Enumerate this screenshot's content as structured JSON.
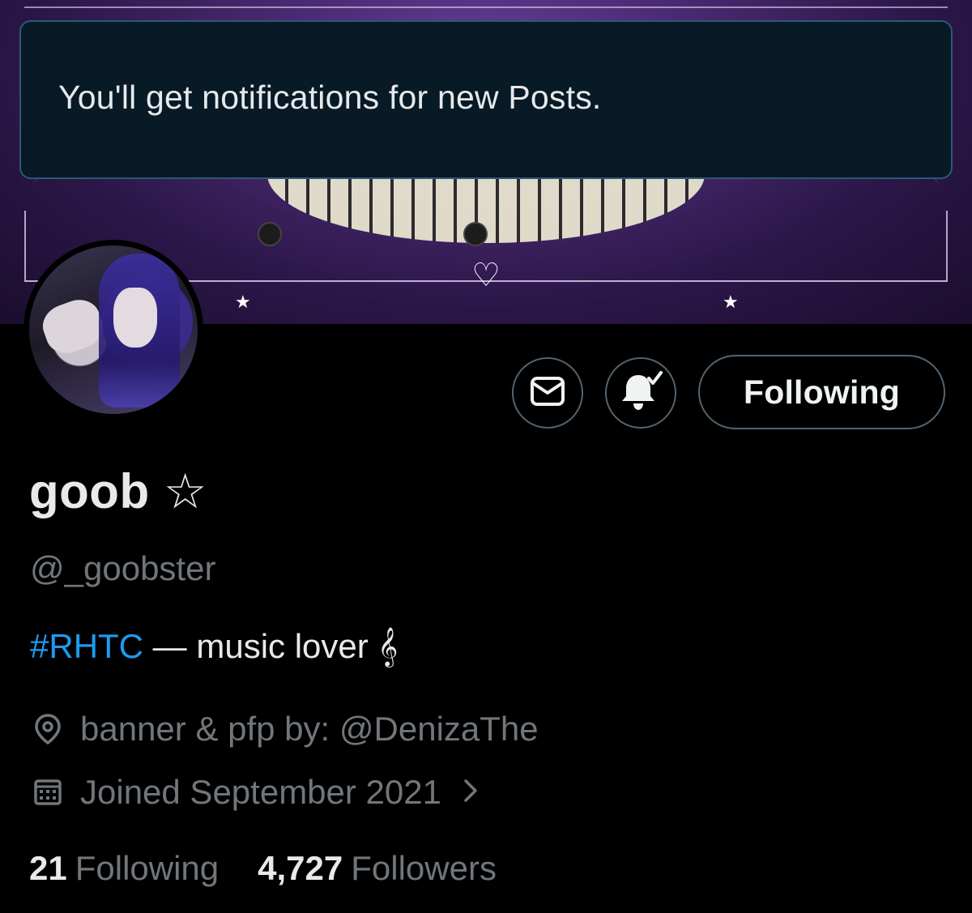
{
  "toast": {
    "message": "You'll get notifications for new Posts."
  },
  "actions": {
    "following_label": "Following",
    "message_icon": "envelope-icon",
    "notify_icon": "bell-check-icon"
  },
  "profile": {
    "display_name": "goob ☆",
    "handle": "@_goobster",
    "bio_hashtag": "#RHTC",
    "bio_rest": " — music lover 𝄞",
    "location": "banner & pfp by: @DenizaThe",
    "joined": "Joined September 2021",
    "location_icon": "location-pin-icon",
    "joined_icon": "calendar-icon"
  },
  "stats": {
    "following_count": "21",
    "following_label": "Following",
    "followers_count": "4,727",
    "followers_label": "Followers"
  },
  "colors": {
    "background": "#000000",
    "accent_link": "#1d9bf0",
    "muted_text": "#71767b",
    "toast_bg": "#071a26",
    "toast_border": "#2d5777"
  }
}
